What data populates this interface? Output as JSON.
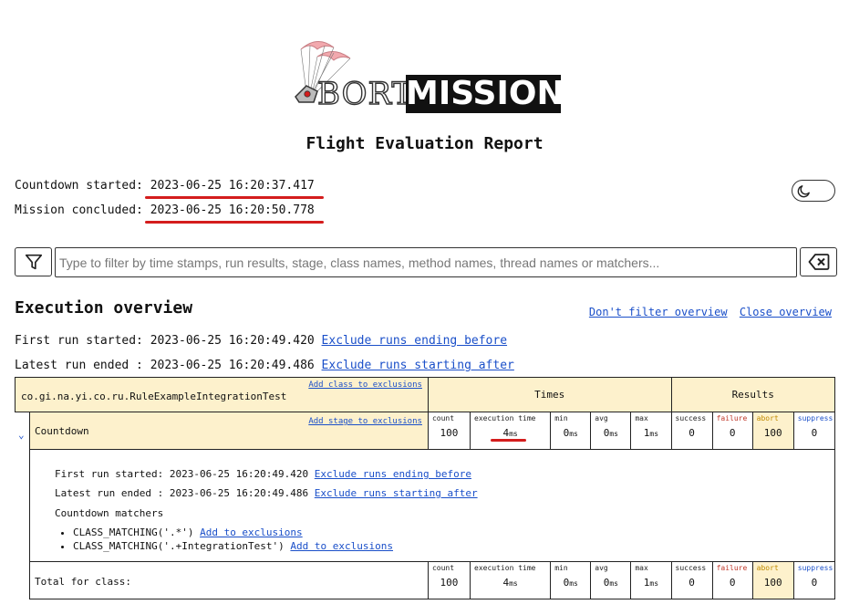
{
  "logo": {
    "abort": "BORT",
    "mission": "MISSION",
    "icon": "parachute-capsule-icon"
  },
  "report_title": "Flight Evaluation Report",
  "countdown": {
    "label": "Countdown started: ",
    "value": "2023-06-25 16:20:37.417"
  },
  "concluded": {
    "label": "Mission concluded: ",
    "value": "2023-06-25 16:20:50.778"
  },
  "theme_toggle": {
    "icon": "moon-icon"
  },
  "filter": {
    "icon": "filter-icon",
    "placeholder": "Type to filter by time stamps, run results, stage, class names, method names, thread names or matchers...",
    "value": "",
    "clear_icon": "backspace-icon"
  },
  "overview": {
    "heading": "Execution overview",
    "dont_filter": "Don't filter overview",
    "close": "Close overview",
    "first_run_label": "First run started: 2023-06-25 16:20:49.420 ",
    "first_run_link": "Exclude runs ending before",
    "latest_run_label": "Latest run ended : 2023-06-25 16:20:49.486 ",
    "latest_run_link": "Exclude runs starting after"
  },
  "table": {
    "class_name": "co.gi.na.yi.co.ru.RuleExampleIntegrationTest",
    "add_class": "Add class to exclusions",
    "times_header": "Times",
    "results_header": "Results",
    "stage": {
      "chevron": "⌄",
      "name": "Countdown",
      "add_stage": "Add stage to exclusions",
      "stats": {
        "count_label": "count",
        "count": "100",
        "exec_label": "execution time",
        "exec": "4",
        "exec_unit": "ms",
        "min_label": "min",
        "min": "0",
        "min_unit": "ms",
        "avg_label": "avg",
        "avg": "0",
        "avg_unit": "ms",
        "max_label": "max",
        "max": "1",
        "max_unit": "ms",
        "success_label": "success",
        "success": "0",
        "failure_label": "failure",
        "failure": "0",
        "abort_label": "abort",
        "abort": "100",
        "suppress_label": "suppress",
        "suppress": "0"
      }
    },
    "details": {
      "first_run_label": "First run started: 2023-06-25 16:20:49.420 ",
      "first_run_link": "Exclude runs ending before",
      "latest_run_label": "Latest run ended : 2023-06-25 16:20:49.486 ",
      "latest_run_link": "Exclude runs starting after",
      "matchers_title": "Countdown matchers",
      "matchers": [
        {
          "text": "CLASS_MATCHING('.*') ",
          "link": "Add to exclusions"
        },
        {
          "text": "CLASS_MATCHING('.+IntegrationTest') ",
          "link": "Add to exclusions"
        }
      ]
    },
    "total": {
      "label": "Total for class:",
      "count_label": "count",
      "count": "100",
      "exec_label": "execution time",
      "exec": "4",
      "exec_unit": "ms",
      "min_label": "min",
      "min": "0",
      "min_unit": "ms",
      "avg_label": "avg",
      "avg": "0",
      "avg_unit": "ms",
      "max_label": "max",
      "max": "1",
      "max_unit": "ms",
      "success_label": "success",
      "success": "0",
      "failure_label": "failure",
      "failure": "0",
      "abort_label": "abort",
      "abort": "100",
      "suppress_label": "suppress",
      "suppress": "0"
    }
  },
  "colors": {
    "highlight": "#fdf1cc",
    "annotation": "#d41d1d",
    "link": "#1a4fc9"
  }
}
